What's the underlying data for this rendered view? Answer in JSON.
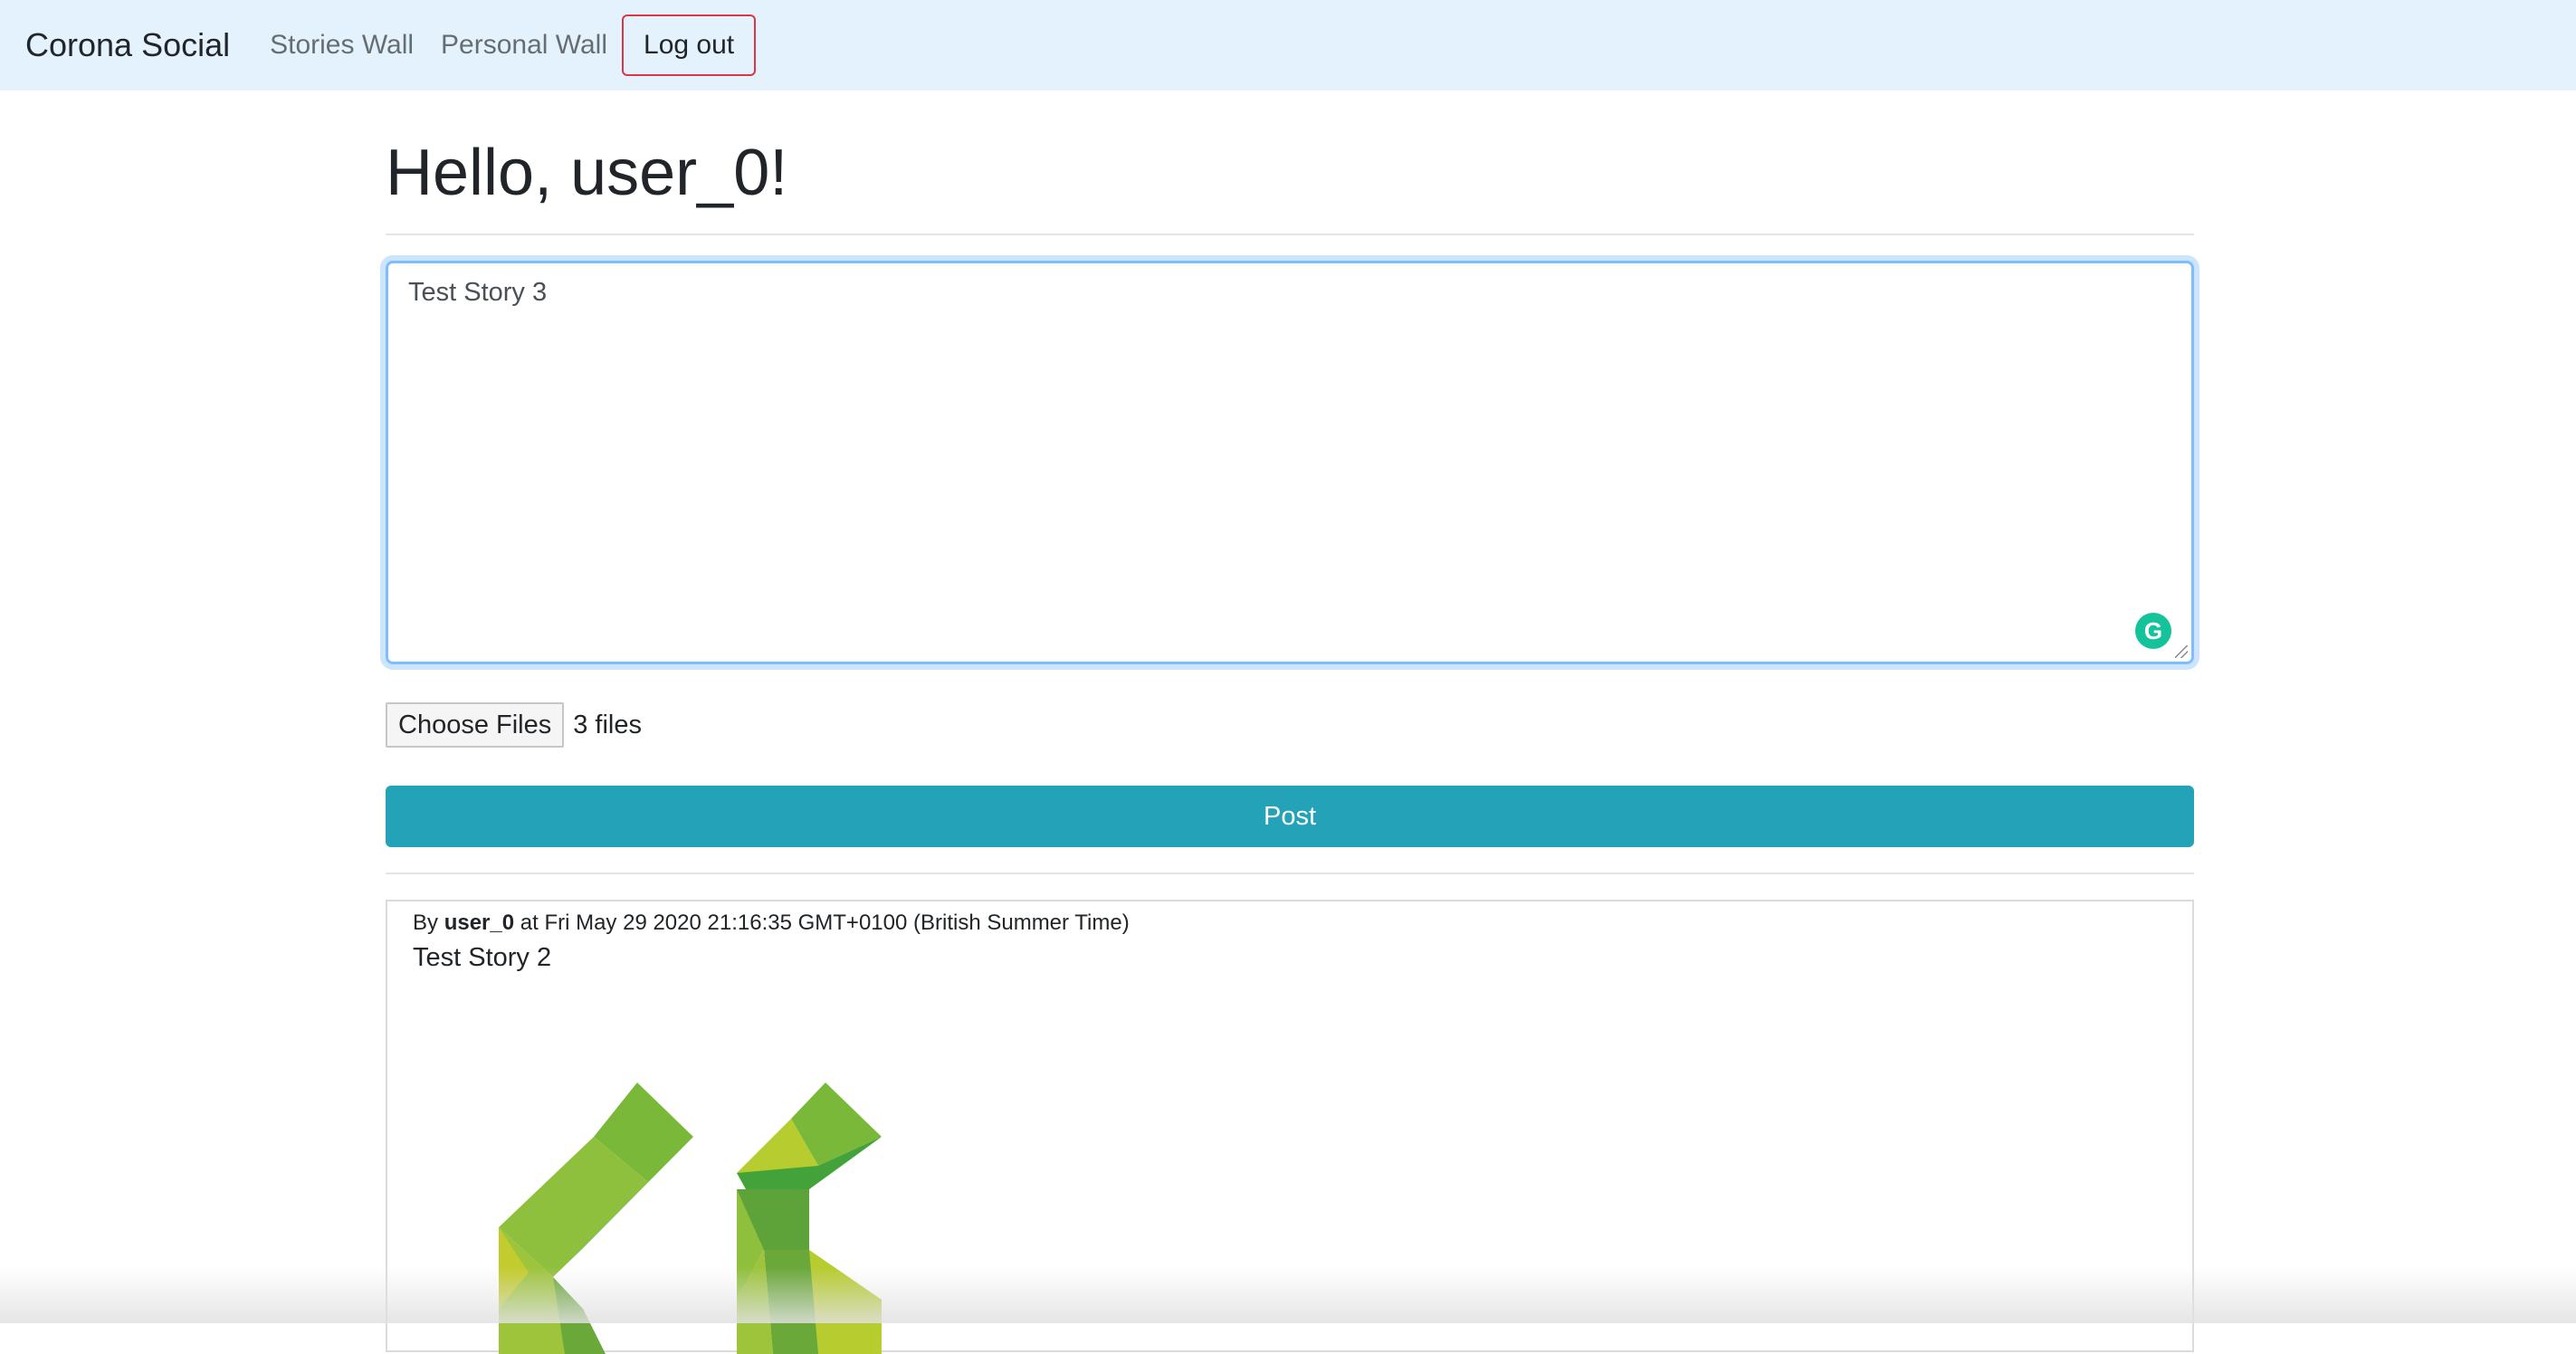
{
  "navbar": {
    "brand": "Corona Social",
    "links": [
      "Stories Wall",
      "Personal Wall"
    ],
    "logout_label": "Log out"
  },
  "main": {
    "greeting": "Hello, user_0!",
    "story_input_value": "Test Story 3",
    "file_button_label": "Choose Files",
    "file_count": "3 files",
    "post_label": "Post"
  },
  "story": {
    "by_label": "By",
    "author": "user_0",
    "at_label": "at",
    "timestamp": "Fri May 29 2020 21:16:35 GMT+0100 (British Summer Time)",
    "text": "Test Story 2",
    "image_icon": "green-double-chevron-logo"
  },
  "colors": {
    "navbar_bg": "#e3f2fd",
    "post_button": "#23a2b8",
    "logout_border": "#dc3545",
    "focus_border": "#80bdff"
  }
}
